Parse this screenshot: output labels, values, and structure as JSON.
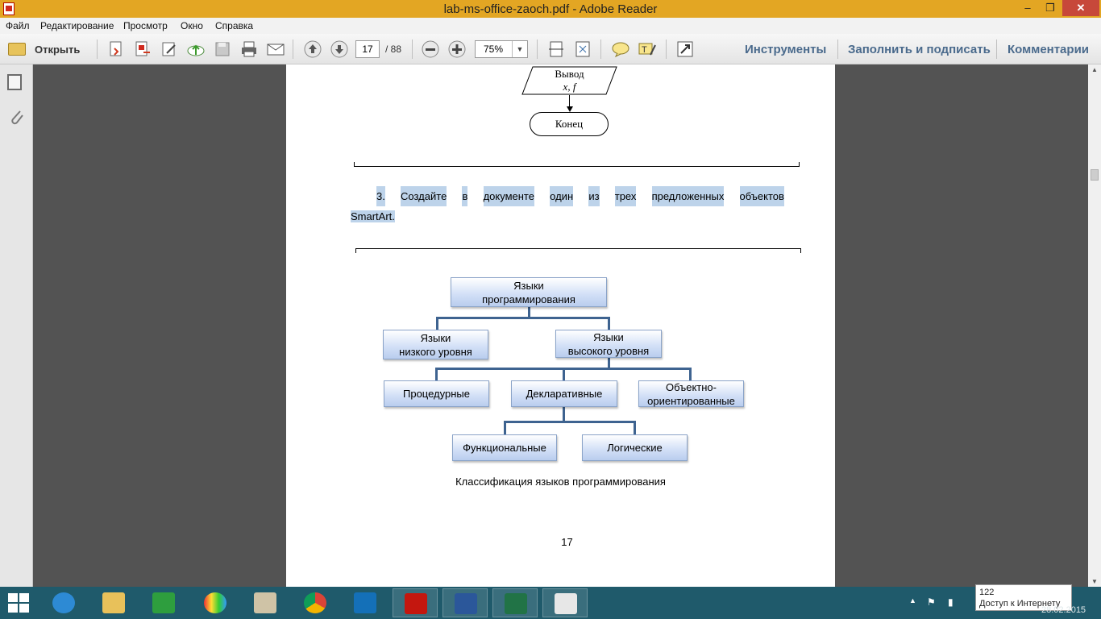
{
  "window": {
    "title": "lab-ms-office-zaoch.pdf - Adobe Reader",
    "minimize_glyph": "‒",
    "maximize_glyph": "❐",
    "close_glyph": "✕"
  },
  "menu": [
    "Файл",
    "Редактирование",
    "Просмотр",
    "Окно",
    "Справка"
  ],
  "toolbar": {
    "open_label": "Открыть",
    "current_page": "17",
    "total_pages": "/ 88",
    "zoom": "75%",
    "tools_label": "Инструменты",
    "fill_sign_label": "Заполнить и подписать",
    "comments_label": "Комментарии"
  },
  "document": {
    "flow_io_label": "Вывод",
    "flow_io_vars": "x, f",
    "flow_end_label": "Конец",
    "task_words": [
      "3.",
      "Создайте",
      "в",
      "документе",
      "один",
      "из",
      "трех",
      "предложенных",
      "объектов"
    ],
    "task_line2": "SmartArt.",
    "smartart": {
      "root_line1": "Языки",
      "root_line2": "программирования",
      "low_line1": "Языки",
      "low_line2": "низкого уровня",
      "high_line1": "Языки",
      "high_line2": "высокого уровня",
      "procedural": "Процедурные",
      "declarative": "Декларативные",
      "oo_line1": "Объектно-",
      "oo_line2": "ориентированные",
      "functional": "Функциональные",
      "logical": "Логические"
    },
    "caption": "Классификация языков программирования",
    "page_number": "17"
  },
  "taskbar": {
    "tooltip_line1": "122",
    "tooltip_line2": "Доступ к Интернету",
    "clock": "28.02.2015"
  },
  "colors": {
    "titlebar": "#e3a623",
    "doc_background": "#535353",
    "smartart_line": "#3e6390",
    "highlight": "#bdd3ea",
    "taskbar": "#1f5a6b"
  }
}
